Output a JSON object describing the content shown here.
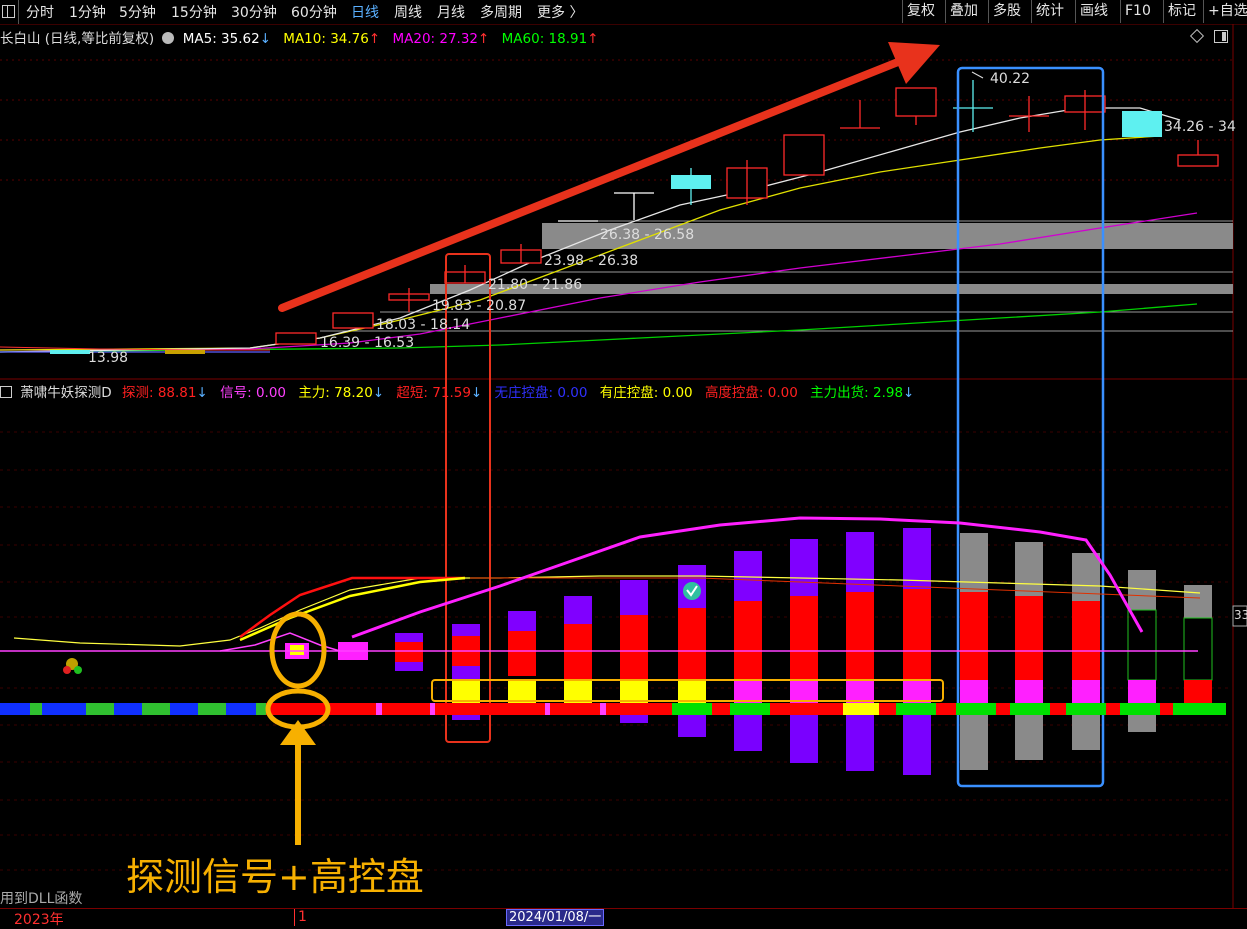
{
  "toolbar": {
    "menu_icon": "grid-icon",
    "tabs": [
      "分时",
      "1分钟",
      "5分钟",
      "15分钟",
      "30分钟",
      "60分钟",
      "日线",
      "周线",
      "月线",
      "多周期",
      "更多 〉"
    ],
    "active_tab": "日线",
    "right_buttons": [
      "复权",
      "叠加",
      "多股",
      "统计",
      "画线",
      "F10",
      "标记",
      "+自选"
    ]
  },
  "price_panel": {
    "title": "长白山 (日线,等比前复权)",
    "ma5_label": "MA5: 35.62",
    "ma5_arrow": "↓",
    "ma10_label": "MA10: 34.76",
    "ma10_arrow": "↑",
    "ma20_label": "MA20: 27.32",
    "ma20_arrow": "↑",
    "ma60_label": "MA60: 18.91",
    "ma60_arrow": "↑",
    "colors": {
      "ma5": "#ffffff",
      "ma10": "#ffff00",
      "ma20": "#ff00ff",
      "ma60": "#00ff00"
    },
    "high_label": "40.22",
    "low_label": "13.98",
    "range_labels": [
      "16.39 - 16.53",
      "18.03 - 18.14",
      "19.83 - 20.87",
      "21.80 - 21.86",
      "23.98 - 26.38",
      "26.38 - 26.58",
      "34.26 - 34"
    ],
    "side_icons": [
      "diamond-icon",
      "panel-icon"
    ]
  },
  "indicator_panel": {
    "title": "萧啸牛妖探测D",
    "items": [
      {
        "label": "探测: 88.81",
        "arrow": "↓",
        "color": "#ff2020"
      },
      {
        "label": "信号: 0.00",
        "arrow": "",
        "color": "#ff40ff"
      },
      {
        "label": "主力: 78.20",
        "arrow": "↓",
        "color": "#ffff00"
      },
      {
        "label": "超短: 71.59",
        "arrow": "↓",
        "color": "#ff2020"
      },
      {
        "label": "无庄控盘: 0.00",
        "arrow": "",
        "color": "#3030ff"
      },
      {
        "label": "有庄控盘: 0.00",
        "arrow": "",
        "color": "#ffff00"
      },
      {
        "label": "高度控盘: 0.00",
        "arrow": "",
        "color": "#ff2020"
      },
      {
        "label": "主力出货: 2.98",
        "arrow": "↓",
        "color": "#00ff00"
      }
    ],
    "right_tick": "33",
    "dll_note": "用到DLL函数"
  },
  "annotation": {
    "text": "探测信号+高控盘",
    "color": "#f7b000"
  },
  "time_axis": {
    "labels": [
      "2023年",
      "1",
      "2024/01/08/一"
    ]
  }
}
